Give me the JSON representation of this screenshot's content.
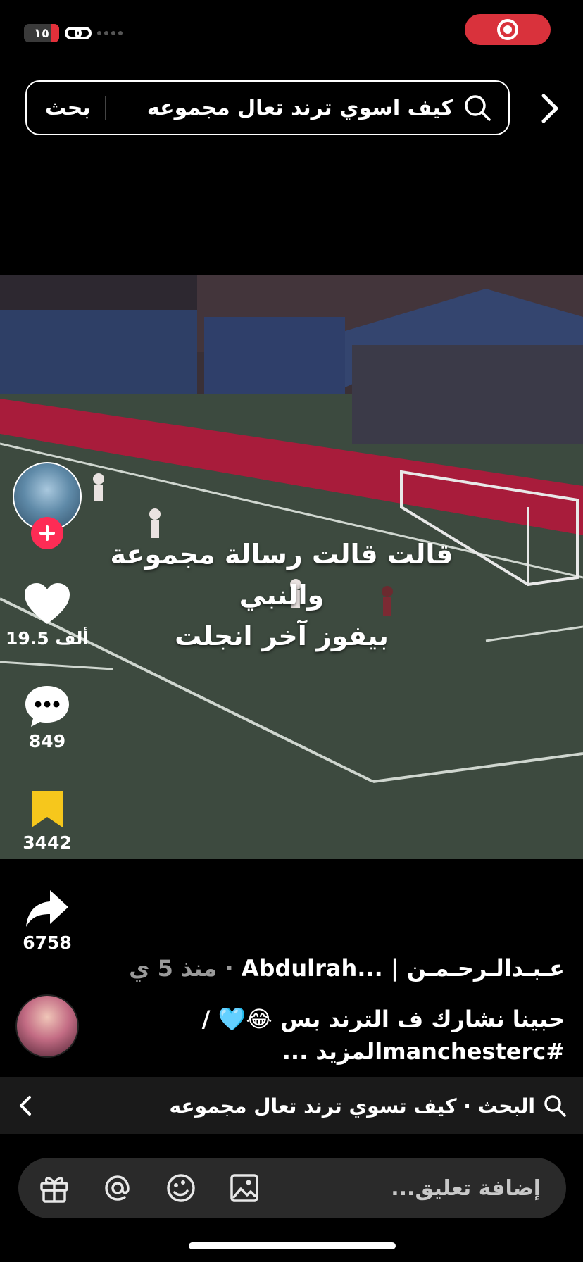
{
  "status": {
    "battery_label": "١٥"
  },
  "search": {
    "query": "كيف اسوي ترند تعال مجموعه",
    "button_label": "بحث"
  },
  "video": {
    "caption_line1": "قالت قالت رسالة مجموعة والنبي",
    "caption_line2": "بيفوز آخر انجلت"
  },
  "actions": {
    "likes": "19.5 ألف",
    "comments": "849",
    "saves": "3442",
    "shares": "6758",
    "save_color": "#f6c71c",
    "follow_color": "#fe2c55"
  },
  "post": {
    "author": "عـبـدالـرحـمـن | ...Abdulrah",
    "time": "منذ 5 ي",
    "separator": "·",
    "desc_line1": "حبينا نشارك ف الترند بس 😂🩵 /",
    "desc_line2": "#manchestercالمزيد ..."
  },
  "related": {
    "label": "البحث · كيف تسوي ترند تعال مجموعه"
  },
  "comment": {
    "placeholder": "إضافة تعليق..."
  }
}
